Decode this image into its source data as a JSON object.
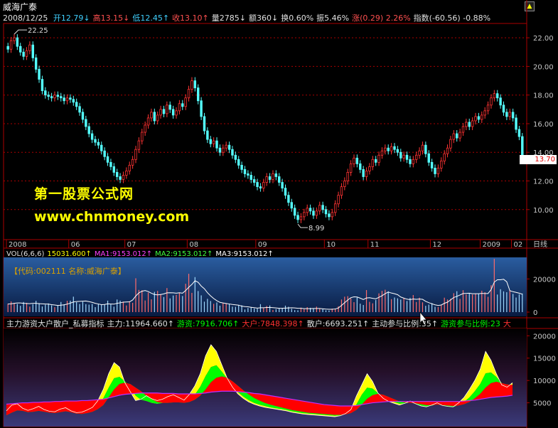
{
  "window": {
    "title": "威海广泰",
    "scroll_icon": "scroll-up-icon"
  },
  "info_row": {
    "date": "2008/12/25",
    "items": [
      {
        "label": "开",
        "value": "12.79",
        "arrow": "↓",
        "color": "#40d0ff"
      },
      {
        "label": "高",
        "value": "13.15",
        "arrow": "↓",
        "color": "#ff5050"
      },
      {
        "label": "低",
        "value": "12.45",
        "arrow": "↑",
        "color": "#40d0ff"
      },
      {
        "label": "收",
        "value": "13.10",
        "arrow": "↑",
        "color": "#ff5050"
      },
      {
        "label": "量",
        "value": "2785",
        "arrow": "↓",
        "color": "#e0e0e0"
      },
      {
        "label": "额",
        "value": "360",
        "arrow": "↓",
        "color": "#e0e0e0"
      },
      {
        "label": "换",
        "value": "0.60%",
        "arrow": "",
        "color": "#e0e0e0"
      },
      {
        "label": "振",
        "value": "5.46%",
        "arrow": "",
        "color": "#e0e0e0"
      },
      {
        "label": "涨",
        "value": "(0.29) 2.26%",
        "arrow": "",
        "color": "#ff5050"
      },
      {
        "label": "指数",
        "value": "(-60.56) -0.88%",
        "arrow": "",
        "color": "#e0e0e0"
      }
    ]
  },
  "watermark": {
    "line1": "第一股票公式网",
    "line2": "www.chnmoney.com"
  },
  "colors": {
    "up": "#ff3333",
    "down": "#54ffff",
    "frame": "#aa0000",
    "grid": "#aa0000",
    "axis_text": "#c8c8c8",
    "yellow": "#ffff00",
    "green": "#00ff00",
    "red": "#ff0000",
    "magenta": "#c030ff"
  },
  "price_panel": {
    "current_price_label": "13.70",
    "high_marker": "22.25",
    "low_marker": "8.99"
  },
  "vol_panel": {
    "header": [
      {
        "text": "VOL(6,6,6)",
        "color": "#e0e0e0"
      },
      {
        "text": "15031.600↑",
        "color": "#ffff00"
      },
      {
        "text": "MA1:9153.012↑",
        "color": "#ff40ff"
      },
      {
        "text": "MA2:9153.012↑",
        "color": "#40ff40"
      },
      {
        "text": "MA3:9153.012↑",
        "color": "#ffffff"
      }
    ],
    "code_label": "【代码:002111 名称:威海广泰】"
  },
  "indicator_panel": {
    "header": [
      {
        "text": "主力游资大户散户_私募指标",
        "color": "#e0e0e0"
      },
      {
        "text": "主力:11964.660↑",
        "color": "#e0e0e0"
      },
      {
        "text": "游资:7916.706↑",
        "color": "#00ff00"
      },
      {
        "text": "大户:7848.398↑",
        "color": "#ff3030"
      },
      {
        "text": "散户:6693.251↑",
        "color": "#e0e0e0"
      },
      {
        "text": "主动参与比例:35↑",
        "color": "#e0e0e0"
      },
      {
        "text": "游资参与比例:23",
        "color": "#00ff00"
      },
      {
        "text": "大",
        "color": "#ff3030"
      }
    ]
  },
  "x_axis": {
    "labels": [
      "2008",
      "06",
      "07",
      "08",
      "09",
      "10",
      "11",
      "12",
      "2009",
      "02"
    ],
    "period_label": "日线"
  },
  "chart_data": [
    {
      "type": "candlestick",
      "ylim": [
        8.5,
        23.0
      ],
      "yticks": [
        10.0,
        12.0,
        14.0,
        16.0,
        18.0,
        20.0,
        22.0
      ],
      "ytick_labels": [
        "10.00",
        "12.00",
        "14.00",
        "16.00",
        "18.00",
        "20.00",
        "22.00"
      ],
      "close": [
        21.2,
        21.8,
        22.0,
        21.4,
        21.0,
        20.7,
        21.1,
        21.5,
        20.6,
        19.8,
        19.1,
        18.3,
        18.0,
        17.9,
        17.8,
        18.0,
        17.9,
        17.8,
        17.6,
        17.8,
        17.7,
        17.5,
        17.2,
        16.8,
        16.3,
        15.8,
        15.3,
        14.9,
        14.7,
        14.5,
        14.1,
        13.7,
        13.3,
        13.0,
        12.6,
        12.3,
        12.1,
        12.4,
        12.7,
        13.1,
        13.5,
        14.2,
        14.8,
        15.4,
        15.9,
        16.4,
        16.8,
        16.2,
        16.6,
        17.0,
        16.7,
        17.3,
        17.0,
        16.6,
        16.9,
        17.4,
        17.2,
        17.8,
        18.4,
        19.0,
        18.5,
        17.6,
        16.5,
        15.5,
        14.9,
        14.6,
        14.8,
        14.3,
        14.0,
        14.3,
        14.5,
        14.2,
        13.8,
        13.5,
        13.1,
        12.8,
        12.5,
        12.4,
        12.1,
        11.9,
        11.6,
        11.5,
        11.9,
        12.3,
        12.1,
        12.5,
        12.3,
        11.9,
        11.5,
        11.0,
        10.5,
        10.1,
        9.6,
        9.3,
        9.5,
        9.8,
        10.1,
        9.9,
        9.6,
        9.9,
        10.3,
        10.0,
        9.7,
        9.5,
        9.8,
        10.4,
        11.0,
        11.6,
        12.0,
        12.6,
        13.2,
        13.6,
        13.2,
        12.8,
        12.3,
        12.7,
        13.0,
        13.5,
        13.3,
        13.8,
        14.1,
        14.3,
        14.1,
        14.4,
        14.2,
        14.0,
        13.6,
        13.8,
        13.5,
        13.2,
        13.5,
        13.8,
        14.1,
        14.5,
        13.9,
        13.3,
        12.9,
        12.5,
        12.9,
        13.4,
        13.9,
        14.3,
        14.9,
        15.3,
        15.0,
        15.4,
        15.8,
        16.1,
        15.8,
        16.2,
        16.5,
        16.3,
        16.6,
        16.9,
        17.3,
        17.8,
        18.1,
        17.8,
        17.3,
        16.8,
        16.5,
        16.8,
        16.4,
        15.6,
        15.1,
        13.7
      ],
      "high_marker": 22.25,
      "low_marker": 8.99,
      "last": 13.7
    },
    {
      "type": "bar",
      "title": "VOL(6,6,6)",
      "ylim": [
        0,
        33000
      ],
      "yticks": [
        0,
        20000
      ],
      "ytick_labels": [
        "0",
        "20000"
      ],
      "values": [
        5100,
        6400,
        5500,
        4900,
        3800,
        6100,
        5600,
        3300,
        4800,
        6800,
        5400,
        3400,
        4500,
        5200,
        4100,
        3000,
        3900,
        6100,
        4700,
        6800,
        6900,
        9300,
        6000,
        4900,
        6300,
        4800,
        4500,
        4900,
        3000,
        4800,
        4400,
        4600,
        6900,
        4700,
        3300,
        7600,
        6900,
        6300,
        4000,
        6500,
        5600,
        20400,
        13400,
        13200,
        7000,
        11800,
        7700,
        12200,
        12800,
        10900,
        9100,
        14500,
        8300,
        10000,
        10400,
        11600,
        9700,
        17100,
        23100,
        11600,
        21100,
        12700,
        10100,
        6300,
        8000,
        6700,
        5000,
        5800,
        3900,
        5600,
        5200,
        4800,
        3300,
        3200,
        4300,
        4100,
        1600,
        2500,
        3100,
        2200,
        2100,
        4800,
        2500,
        3700,
        4000,
        1300,
        1800,
        2400,
        2500,
        3900,
        3200,
        2000,
        1200,
        1100,
        2700,
        1800,
        3000,
        2600,
        2300,
        3300,
        2100,
        1800,
        1100,
        1000,
        2100,
        2000,
        3500,
        7600,
        9300,
        9600,
        8200,
        6000,
        8800,
        5100,
        4300,
        13300,
        6200,
        5300,
        7300,
        11300,
        12800,
        13500,
        12500,
        7800,
        8800,
        8300,
        7600,
        8400,
        6700,
        8600,
        10300,
        6100,
        8700,
        5900,
        3800,
        4500,
        5400,
        3200,
        3100,
        4200,
        8700,
        7600,
        8100,
        11400,
        12600,
        8000,
        13200,
        10700,
        11500,
        10600,
        10900,
        10900,
        12900,
        12000,
        9200,
        16200,
        32100,
        10600,
        13800,
        12500,
        12000,
        13000,
        11000,
        8800,
        10700,
        11200
      ],
      "ma": [
        4900,
        5000,
        5300,
        5500,
        5500,
        5300,
        5200,
        5100,
        5300,
        5300,
        5100,
        5000,
        4900,
        4800,
        4500,
        4300,
        4000,
        4200,
        4400,
        4800,
        5400,
        6100,
        6400,
        6500,
        6600,
        6700,
        6300,
        5900,
        5300,
        4900,
        4500,
        4600,
        5000,
        4900,
        4800,
        5300,
        5600,
        6000,
        6100,
        6200,
        7300,
        9700,
        11600,
        12600,
        13000,
        12400,
        11400,
        10600,
        10400,
        10600,
        11000,
        11600,
        11700,
        11600,
        11400,
        11700,
        11400,
        13000,
        15000,
        16700,
        18900,
        18000,
        15700,
        14100,
        11700,
        9800,
        8200,
        6900,
        5900,
        5500,
        5200,
        4900,
        4600,
        4400,
        4200,
        3600,
        3300,
        3200,
        2900,
        2700,
        2400,
        2600,
        2600,
        2800,
        2800,
        2700,
        2500,
        2300,
        2300,
        2400,
        2500,
        2600,
        2500,
        2300,
        2300,
        2100,
        2100,
        2100,
        2200,
        2200,
        2200,
        2000,
        1800,
        1700,
        1700,
        1900,
        2500,
        4000,
        5700,
        7300,
        8700,
        9200,
        9100,
        8400,
        7600,
        8500,
        8700,
        8300,
        8000,
        8900,
        9900,
        11100,
        12100,
        11500,
        11100,
        10500,
        9100,
        8400,
        7800,
        7500,
        7900,
        7700,
        7900,
        7700,
        6500,
        5700,
        5000,
        4400,
        4000,
        4300,
        5300,
        6000,
        7400,
        8800,
        9500,
        10300,
        11200,
        11300,
        11400,
        11100,
        11100,
        11100,
        11300,
        11200,
        11200,
        13600,
        18100,
        19500,
        19500,
        19800,
        18300,
        12900,
        12300,
        11900,
        11400,
        10800
      ],
      "current": 15031.6,
      "ma1": 9153.012,
      "ma2": 9153.012,
      "ma3": 9153.012
    },
    {
      "type": "area",
      "title": "主力游资大户散户_私募指标",
      "ylim": [
        0,
        21000
      ],
      "yticks": [
        5000,
        10000,
        15000,
        20000
      ],
      "ytick_labels": [
        "5000",
        "10000",
        "15000",
        "20000"
      ],
      "series": [
        {
          "name": "主力",
          "values": [
            3200,
            4500,
            4800,
            3800,
            3300,
            3700,
            4200,
            3500,
            3100,
            3000,
            3600,
            3900,
            3200,
            2800,
            2900,
            3400,
            4000,
            5500,
            8000,
            11500,
            14000,
            13000,
            9500,
            7500,
            5500,
            5800,
            6600,
            5900,
            5500,
            5800,
            6400,
            6800,
            6200,
            5600,
            6900,
            8800,
            11500,
            15500,
            18000,
            16500,
            13500,
            10500,
            8500,
            7000,
            6000,
            5200,
            4700,
            4300,
            4000,
            3800,
            3600,
            3400,
            3200,
            2900,
            2700,
            2500,
            2400,
            2300,
            2200,
            2100,
            2000,
            1900,
            2100,
            2600,
            3500,
            6500,
            9000,
            11500,
            9800,
            7200,
            6000,
            5300,
            4900,
            4500,
            4900,
            5400,
            4800,
            4300,
            4100,
            4500,
            5000,
            4400,
            4200,
            4100,
            5000,
            6200,
            8000,
            10000,
            12500,
            16500,
            14500,
            11500,
            9000,
            8500,
            9500
          ]
        },
        {
          "name": "游资",
          "values": [
            2600,
            3600,
            4000,
            3400,
            3000,
            3300,
            3600,
            3200,
            2800,
            2800,
            3200,
            3400,
            2900,
            2600,
            2600,
            3000,
            3400,
            4400,
            6000,
            8400,
            10500,
            10800,
            9800,
            8600,
            6600,
            5700,
            5400,
            5000,
            4800,
            5000,
            5300,
            5600,
            5300,
            5000,
            5700,
            6800,
            8600,
            11000,
            13000,
            13400,
            12000,
            10400,
            8800,
            7400,
            6400,
            5600,
            5000,
            4600,
            4300,
            4000,
            3800,
            3600,
            3400,
            3100,
            2900,
            2700,
            2600,
            2500,
            2400,
            2300,
            2200,
            2100,
            2200,
            2500,
            3000,
            4600,
            6800,
            8400,
            8200,
            7200,
            6200,
            5600,
            5200,
            4800,
            4900,
            5100,
            4800,
            4400,
            4200,
            4400,
            4700,
            4400,
            4200,
            4100,
            4500,
            5200,
            6200,
            7600,
            9200,
            11600,
            11800,
            10800,
            9400,
            8800,
            9000
          ]
        },
        {
          "name": "大户",
          "values": [
            2200,
            2800,
            3300,
            3200,
            2900,
            3000,
            3200,
            3000,
            2800,
            2700,
            2900,
            3100,
            2900,
            2600,
            2500,
            2700,
            3000,
            3600,
            4500,
            6200,
            8000,
            9200,
            9500,
            9200,
            8400,
            7600,
            6600,
            5800,
            5200,
            5000,
            5000,
            5100,
            5100,
            5000,
            5200,
            5700,
            6600,
            8000,
            9600,
            10600,
            10900,
            10600,
            9800,
            8800,
            7800,
            6900,
            6100,
            5500,
            5000,
            4600,
            4300,
            4000,
            3700,
            3400,
            3200,
            3000,
            2800,
            2700,
            2600,
            2500,
            2400,
            2300,
            2300,
            2400,
            2700,
            3400,
            4600,
            5900,
            6700,
            7000,
            6800,
            6300,
            5800,
            5300,
            5100,
            5000,
            4900,
            4700,
            4500,
            4500,
            4600,
            4500,
            4400,
            4300,
            4400,
            4700,
            5200,
            6000,
            7000,
            8400,
            9400,
            9700,
            9400,
            9100,
            9000
          ]
        },
        {
          "name": "散户",
          "values": [
            4700,
            4800,
            4900,
            5000,
            5000,
            5100,
            5100,
            5200,
            5200,
            5300,
            5300,
            5400,
            5400,
            5400,
            5500,
            5500,
            5600,
            5700,
            5800,
            6100,
            6400,
            6700,
            6900,
            7000,
            7100,
            7200,
            7200,
            7200,
            7200,
            7100,
            7100,
            7100,
            7000,
            7000,
            7000,
            7000,
            7100,
            7200,
            7400,
            7500,
            7600,
            7600,
            7600,
            7500,
            7400,
            7300,
            7100,
            7000,
            6800,
            6600,
            6400,
            6200,
            6000,
            5800,
            5600,
            5400,
            5200,
            5000,
            4800,
            4600,
            4500,
            4400,
            4300,
            4300,
            4300,
            4400,
            4600,
            4800,
            5000,
            5100,
            5200,
            5300,
            5300,
            5300,
            5300,
            5300,
            5300,
            5300,
            5300,
            5300,
            5300,
            5300,
            5300,
            5300,
            5300,
            5400,
            5500,
            5600,
            5800,
            6000,
            6200,
            6300,
            6400,
            6500,
            6690
          ]
        }
      ],
      "last": {
        "主力": 11964.66,
        "游资": 7916.706,
        "大户": 7848.398,
        "散户": 6693.251,
        "主动参与比例": 35,
        "游资参与比例": 23
      }
    }
  ]
}
